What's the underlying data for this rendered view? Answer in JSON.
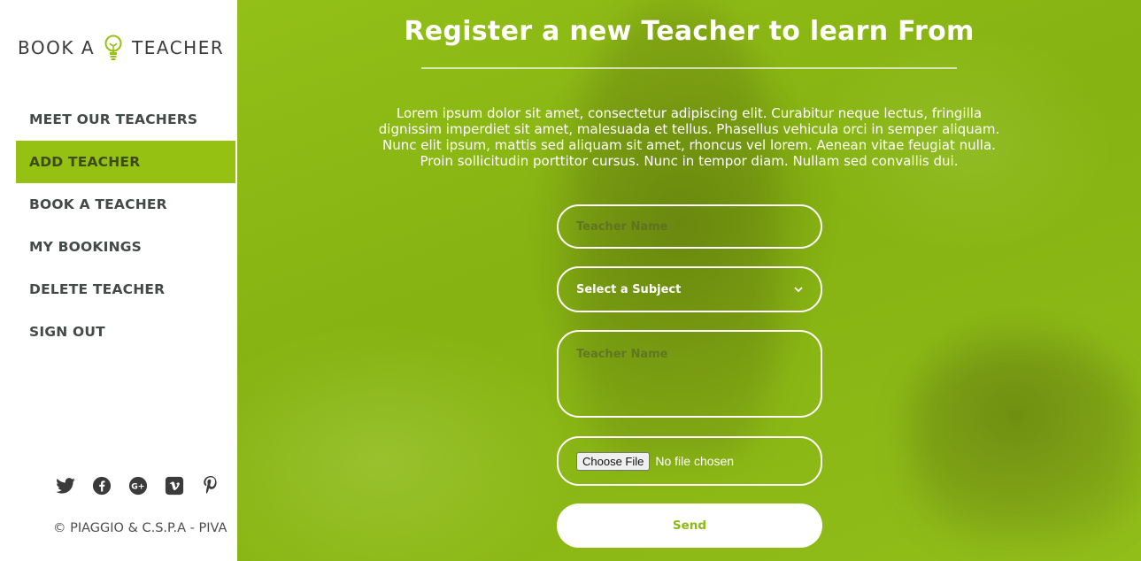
{
  "brand": {
    "left": "BOOK A",
    "right": "TEACHER"
  },
  "nav": {
    "items": [
      {
        "label": "MEET OUR TEACHERS"
      },
      {
        "label": "ADD TEACHER"
      },
      {
        "label": "BOOK A TEACHER"
      },
      {
        "label": "MY BOOKINGS"
      },
      {
        "label": "DELETE TEACHER"
      },
      {
        "label": "SIGN OUT"
      }
    ],
    "active": "ADD TEACHER"
  },
  "socials": [
    "twitter-icon",
    "facebook-icon",
    "google-plus-icon",
    "vimeo-icon",
    "pinterest-icon"
  ],
  "footer": {
    "copyright": "© PIAGGIO & C.S.P.A - PIVA"
  },
  "main": {
    "title": "Register a new Teacher to learn From",
    "intro": "Lorem ipsum dolor sit amet, consectetur adipiscing elit. Curabitur neque lectus, fringilla dignissim imperdiet sit amet, malesuada et tellus. Phasellus vehicula orci in semper aliquam. Nunc elit ipsum, mattis sed aliquam sit amet, rhoncus vel lorem. Aenean vitae feugiat nulla. Proin sollicitudin porttitor cursus. Nunc in tempor diam. Nullam sed convallis dui."
  },
  "form": {
    "name_placeholder": "Teacher Name",
    "subject_selected": "Select a Subject",
    "message_placeholder": "Teacher Name",
    "file_button": "Choose File",
    "file_status": "No file chosen",
    "send_label": "Send"
  },
  "colors": {
    "accent": "#94c112",
    "background_tint": "#8cba14",
    "text_dark": "#444a48",
    "white": "#ffffff"
  }
}
